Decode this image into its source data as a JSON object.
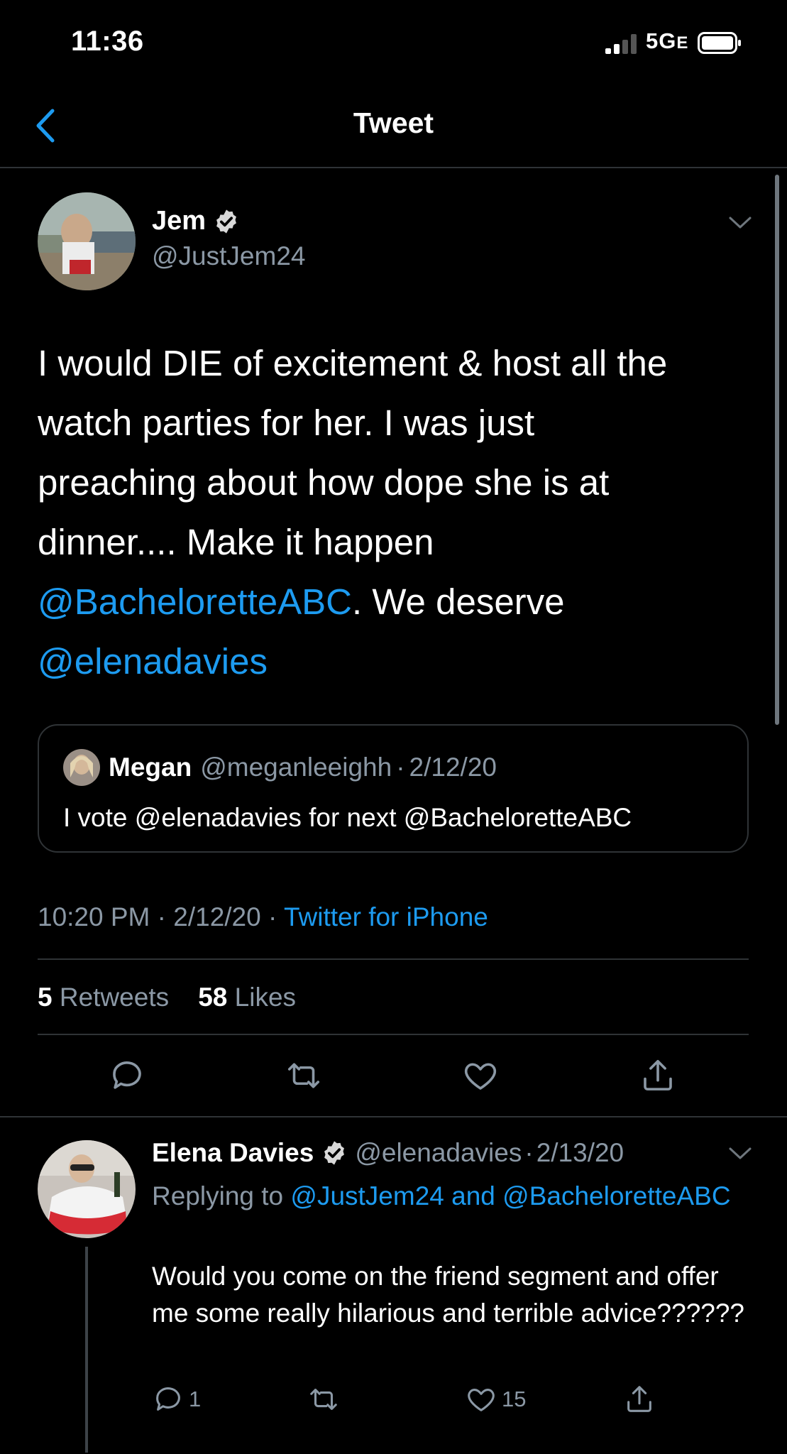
{
  "status_bar": {
    "time": "11:36",
    "network": "5G",
    "network_suffix": "E"
  },
  "nav": {
    "title": "Tweet"
  },
  "colors": {
    "accent": "#1d9bf0",
    "secondary_text": "#8b98a5",
    "divider": "#2f3336"
  },
  "tweet": {
    "author_name": "Jem",
    "author_handle": "@JustJem24",
    "text_lines": [
      {
        "plain": "I would DIE of excitement & host all the"
      },
      {
        "plain": "watch parties for her. I was just"
      },
      {
        "plain": "preaching about how dope she is at"
      },
      {
        "plain": "dinner.... Make it happen"
      }
    ],
    "mention1": "@BacheloretteABC",
    "after_mention1": ". We deserve",
    "mention2": "@elenadavies",
    "quote": {
      "name": "Megan",
      "handle": "@meganleeighh",
      "sep": "·",
      "date": "2/12/20",
      "text": "I vote @elenadavies for next @BacheloretteABC"
    },
    "time": "10:20 PM",
    "date": "2/12/20",
    "sep": "·",
    "source": "Twitter for iPhone",
    "retweets": {
      "count": "5",
      "label": "Retweets"
    },
    "likes": {
      "count": "58",
      "label": "Likes"
    }
  },
  "reply": {
    "author_name": "Elena Davies",
    "author_handle": "@elenadavies",
    "sep": "·",
    "date": "2/13/20",
    "replying_prefix": "Replying to",
    "replying_targets": "@JustJem24 and @BacheloretteABC",
    "text": "Would you come on the friend segment and offer me some really hilarious and terrible advice??????",
    "reply_count": "1",
    "like_count": "15"
  },
  "icons": [
    "signal-icon",
    "battery-icon",
    "back-chevron-icon",
    "verified-badge-icon",
    "chevron-down-icon",
    "reply-icon",
    "retweet-icon",
    "like-icon",
    "share-icon"
  ]
}
